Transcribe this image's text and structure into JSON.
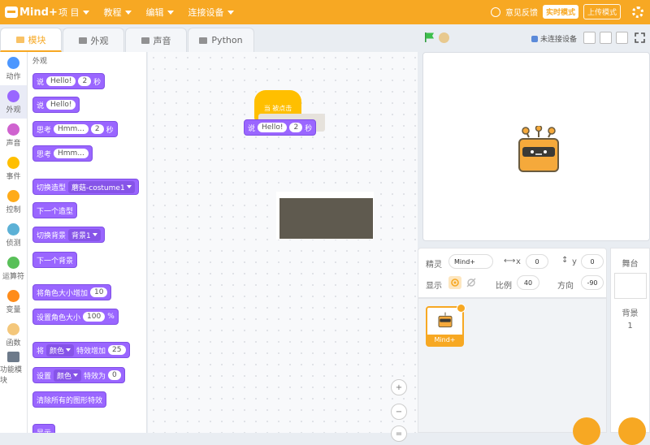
{
  "topbar": {
    "logo": "Mind+",
    "menus": [
      {
        "label": "项 目"
      },
      {
        "label": "教程"
      },
      {
        "label": "编辑"
      },
      {
        "label": "连接设备"
      }
    ],
    "feedback": "意见反馈",
    "mode_active": "实时模式",
    "mode_upload": "上传模式"
  },
  "tabs": [
    {
      "label": "模块"
    },
    {
      "label": "外观"
    },
    {
      "label": "声音"
    },
    {
      "label": "Python"
    }
  ],
  "categories": [
    {
      "label": "动作",
      "color": "#4c97ff"
    },
    {
      "label": "外观",
      "color": "#9966ff"
    },
    {
      "label": "声音",
      "color": "#cf63cf"
    },
    {
      "label": "事件",
      "color": "#ffbf00"
    },
    {
      "label": "控制",
      "color": "#ffab19"
    },
    {
      "label": "侦测",
      "color": "#5cb1d6"
    },
    {
      "label": "运算符",
      "color": "#59c059"
    },
    {
      "label": "变量",
      "color": "#ff8c1a"
    },
    {
      "label": "函数",
      "color": "#f4c77b"
    },
    {
      "label": "功能模块",
      "color": "#6d7a8a"
    }
  ],
  "palette": {
    "heading": "外观",
    "blocks": [
      {
        "parts": [
          "说",
          "Hello!",
          "2",
          "秒"
        ]
      },
      {
        "parts": [
          "说",
          "Hello!"
        ]
      },
      {
        "parts": [
          "思考",
          "Hmm...",
          "2",
          "秒"
        ]
      },
      {
        "parts": [
          "思考",
          "Hmm..."
        ]
      },
      {
        "parts": [
          "切换造型",
          "蘑菇-costume1"
        ]
      },
      {
        "parts": [
          "下一个造型"
        ]
      },
      {
        "parts": [
          "切换背景",
          "背景1"
        ]
      },
      {
        "parts": [
          "下一个背景"
        ]
      },
      {
        "parts": [
          "将角色大小增加",
          "10"
        ]
      },
      {
        "parts": [
          "设置角色大小",
          "100",
          "%"
        ]
      },
      {
        "parts": [
          "将",
          "颜色",
          "特效增加",
          "25"
        ]
      },
      {
        "parts": [
          "设置",
          "颜色",
          "特效为",
          "0"
        ]
      },
      {
        "parts": [
          "清除所有的图形特效"
        ]
      },
      {
        "parts": [
          "显示"
        ]
      }
    ]
  },
  "workspace": {
    "hat_label": "当 被点击",
    "say_block": [
      "说",
      "Hello!",
      "2",
      "秒"
    ],
    "zoom_in": "+",
    "zoom_out": "−",
    "zoom_reset": "="
  },
  "stage_toolbar": {
    "connection": "未连接设备"
  },
  "sprite_info": {
    "sprite_label": "精灵",
    "sprite_name": "Mind+",
    "x_label": "x",
    "x_value": "0",
    "y_label": "y",
    "y_value": "0",
    "show_label": "显示",
    "size_label": "比例",
    "size_value": "40",
    "direction_label": "方向",
    "direction_value": "-90"
  },
  "sprite_list": [
    {
      "name": "Mind+"
    }
  ],
  "stage_panel": {
    "title": "舞台",
    "backdrop_label": "背景",
    "backdrop_count": "1"
  }
}
